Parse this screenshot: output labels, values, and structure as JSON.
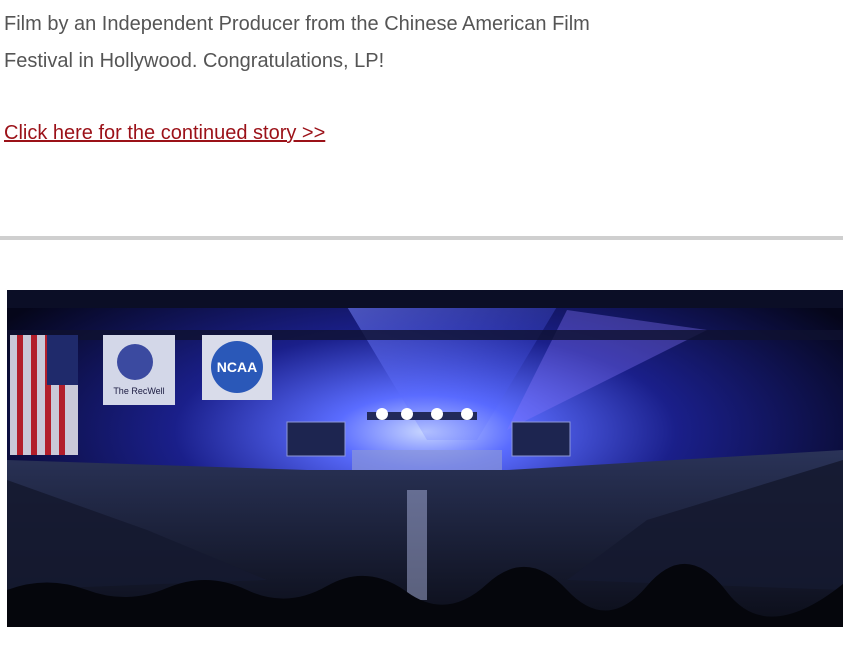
{
  "article": {
    "paragraph_line1": "Film by an Independent Producer from the Chinese American Film",
    "paragraph_line2": "Festival in Hollywood. Congratulations, LP!",
    "continued_link": "Click here for the continued story >>"
  },
  "photo": {
    "subject": "concert-arena-crowd",
    "banners": [
      "The RecWell",
      "NCAA"
    ]
  },
  "colors": {
    "body_text": "#555555",
    "link": "#9b1118",
    "divider": "#cfcfcf",
    "stage_light": "#3a4cff"
  }
}
